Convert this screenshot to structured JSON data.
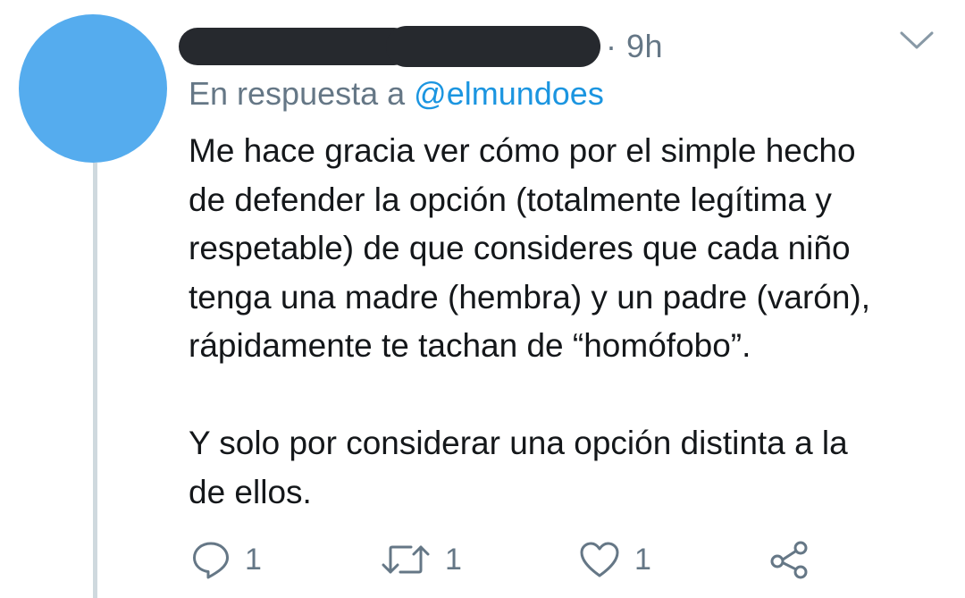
{
  "colors": {
    "avatar": "#55acee",
    "text_primary": "#14171a",
    "text_secondary": "#657786",
    "link": "#1b95e0",
    "thread_line": "#cfd9de",
    "redaction": "#26292e"
  },
  "tweet": {
    "author_name": "",
    "timestamp": "· 9h",
    "reply_prefix": "En respuesta a ",
    "reply_mention": "@elmundoes",
    "text": {
      "paragraph1": [
        "Me hace gracia ver cómo por el simple hecho",
        "de defender la opción (totalmente legítima y",
        "respetable) de que consideres que cada niño",
        "tenga una madre (hembra) y un padre (varón),",
        "rápidamente te tachan de “homófobo”."
      ],
      "paragraph2": [
        "Y solo por considerar una opción distinta a la",
        "de ellos."
      ]
    },
    "actions": {
      "reply_count": "1",
      "retweet_count": "1",
      "like_count": "1"
    },
    "icons": {
      "menu": "chevron-down-icon",
      "reply": "reply-icon",
      "retweet": "retweet-icon",
      "like": "heart-icon",
      "share": "share-icon"
    }
  }
}
